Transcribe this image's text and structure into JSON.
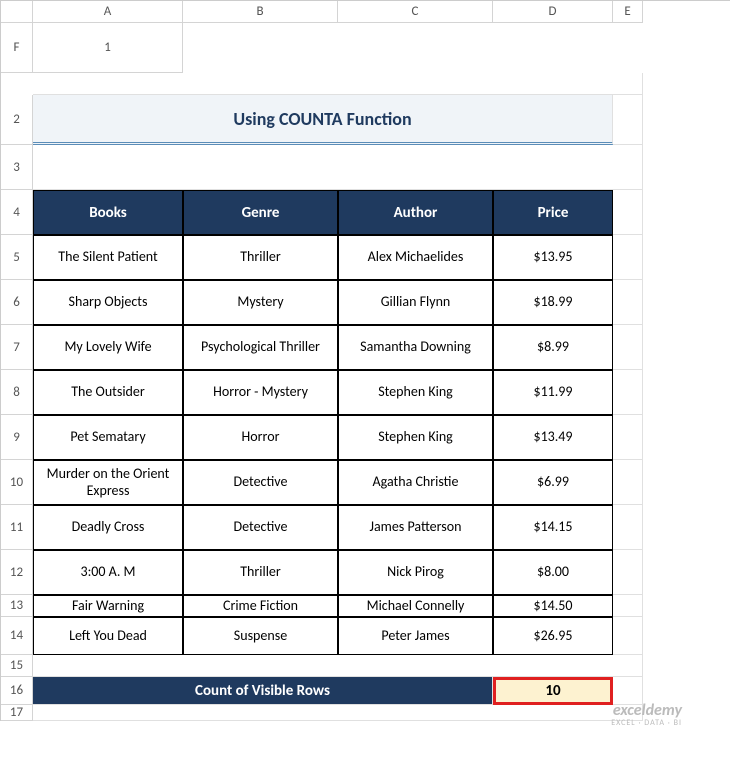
{
  "columns": [
    "A",
    "B",
    "C",
    "D",
    "E",
    "F"
  ],
  "rows": [
    "1",
    "2",
    "3",
    "4",
    "5",
    "6",
    "7",
    "8",
    "9",
    "10",
    "11",
    "12",
    "13",
    "14",
    "15",
    "16",
    "17"
  ],
  "title": "Using COUNTA Function",
  "headers": {
    "books": "Books",
    "genre": "Genre",
    "author": "Author",
    "price": "Price"
  },
  "data": [
    {
      "book": "The Silent Patient",
      "genre": "Thriller",
      "author": "Alex Michaelides",
      "price": "$13.95"
    },
    {
      "book": "Sharp Objects",
      "genre": "Mystery",
      "author": "Gillian Flynn",
      "price": "$18.99"
    },
    {
      "book": "My Lovely Wife",
      "genre": "Psychological Thriller",
      "author": "Samantha Downing",
      "price": "$8.99"
    },
    {
      "book": "The Outsider",
      "genre": "Horror - Mystery",
      "author": "Stephen King",
      "price": "$11.99"
    },
    {
      "book": "Pet Sematary",
      "genre": "Horror",
      "author": "Stephen King",
      "price": "$13.49"
    },
    {
      "book": "Murder on the Orient Express",
      "genre": "Detective",
      "author": "Agatha Christie",
      "price": "$6.99"
    },
    {
      "book": "Deadly Cross",
      "genre": "Detective",
      "author": "James Patterson",
      "price": "$14.15"
    },
    {
      "book": "3:00 A. M",
      "genre": "Thriller",
      "author": "Nick Pirog",
      "price": "$8.00"
    },
    {
      "book": "Fair Warning",
      "genre": "Crime Fiction",
      "author": "Michael Connelly",
      "price": "$14.50"
    },
    {
      "book": "Left You Dead",
      "genre": "Suspense",
      "author": "Peter James",
      "price": "$26.95"
    }
  ],
  "count_label": "Count of Visible Rows",
  "count_value": "10",
  "watermark": {
    "title": "exceldemy",
    "sub": "EXCEL · DATA · BI"
  },
  "chart_data": {
    "type": "table",
    "title": "Using COUNTA Function",
    "columns": [
      "Books",
      "Genre",
      "Author",
      "Price"
    ],
    "rows": [
      [
        "The Silent Patient",
        "Thriller",
        "Alex Michaelides",
        13.95
      ],
      [
        "Sharp Objects",
        "Mystery",
        "Gillian Flynn",
        18.99
      ],
      [
        "My Lovely Wife",
        "Psychological Thriller",
        "Samantha Downing",
        8.99
      ],
      [
        "The Outsider",
        "Horror - Mystery",
        "Stephen King",
        11.99
      ],
      [
        "Pet Sematary",
        "Horror",
        "Stephen King",
        13.49
      ],
      [
        "Murder on the Orient Express",
        "Detective",
        "Agatha Christie",
        6.99
      ],
      [
        "Deadly Cross",
        "Detective",
        "James Patterson",
        14.15
      ],
      [
        "3:00 A. M",
        "Thriller",
        "Nick Pirog",
        8.0
      ],
      [
        "Fair Warning",
        "Crime Fiction",
        "Michael Connelly",
        14.5
      ],
      [
        "Left You Dead",
        "Suspense",
        "Peter James",
        26.95
      ]
    ],
    "summary": {
      "label": "Count of Visible Rows",
      "value": 10
    }
  }
}
